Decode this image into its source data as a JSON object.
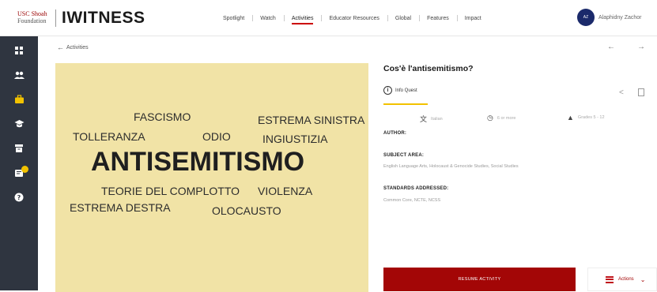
{
  "header": {
    "logo_usc_line1": "USC Shoah",
    "logo_usc_line2": "Foundation",
    "logo_iwitness": "IWITNESS",
    "nav": [
      "Spotlight",
      "Watch",
      "Activities",
      "Educator Resources",
      "Global",
      "Features",
      "Impact"
    ],
    "active_nav": "Activities",
    "user": {
      "initials": "AZ",
      "name": "Alaphidny Zachor"
    }
  },
  "sidebar": {
    "icons": [
      "dashboard-icon",
      "people-icon",
      "briefcase-icon",
      "graduation-cap-icon",
      "archive-icon",
      "inbox-icon",
      "help-icon"
    ],
    "active_icon": "briefcase-icon",
    "accent": "#f2c200"
  },
  "main": {
    "back_label": "Activities",
    "pager": {
      "prev": "←",
      "next": "→"
    },
    "word_cloud": {
      "background": "#f1e3a6",
      "words": [
        "FASCISMO",
        "ESTREMA SINISTRA",
        "TOLLERANZA",
        "ODIO",
        "INGIUSTIZIA",
        "ANTISEMITISMO",
        "TEORIE DEL COMPLOTTO",
        "VIOLENZA",
        "ESTREMA DESTRA",
        "OLOCAUSTO"
      ]
    },
    "details": {
      "title": "Cos'è l'antisemitismo?",
      "type_icon": "i",
      "type_label": "Info Quest",
      "meta": {
        "language": "Italian",
        "duration": "6 or more",
        "grades": "Grades 5 - 12"
      },
      "author_label": "AUTHOR:",
      "subject_label": "SUBJECT AREA:",
      "subject_value": "English Language Arts, Holocaust & Genocide Studies, Social Studies",
      "standards_label": "STANDARDS ADDRESSED:",
      "standards_value": "Common Core, NCTE, NCSS",
      "resume_button": "RESUME ACTIVITY",
      "actions_button": "Actions",
      "brand_red": "#a30606"
    }
  }
}
